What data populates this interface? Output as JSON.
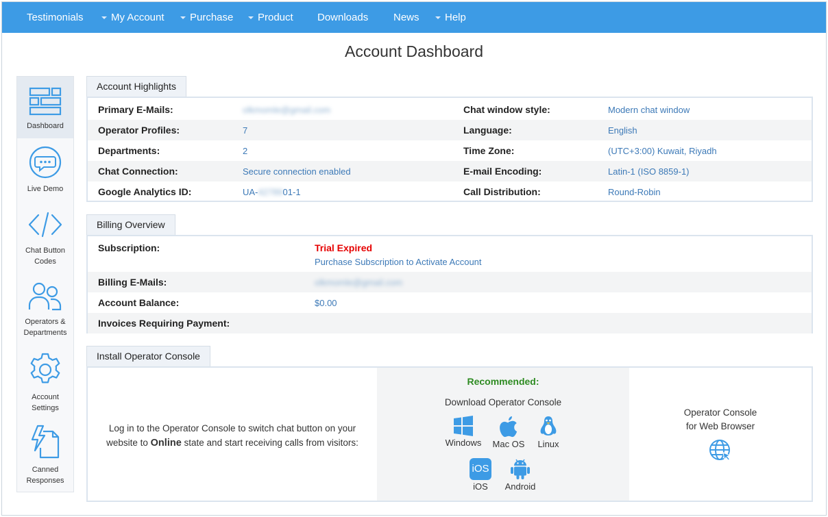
{
  "nav": {
    "items": [
      {
        "label": "Testimonials",
        "has_caret": false
      },
      {
        "label": "My Account",
        "has_caret": true
      },
      {
        "label": "Purchase",
        "has_caret": true
      },
      {
        "label": "Product",
        "has_caret": true
      },
      {
        "label": "Downloads",
        "has_caret": false
      },
      {
        "label": "News",
        "has_caret": false
      },
      {
        "label": "Help",
        "has_caret": true
      }
    ],
    "bg_color": "#3d9be5"
  },
  "page_title": "Account Dashboard",
  "sidebar": {
    "items": [
      {
        "label": "Dashboard",
        "icon": "dashboard-icon",
        "active": true
      },
      {
        "label": "Live Demo",
        "icon": "chat-bubble-icon",
        "active": false
      },
      {
        "label": "Chat Button Codes",
        "icon": "code-icon",
        "active": false
      },
      {
        "label": "Operators & Departments",
        "icon": "users-icon",
        "active": false
      },
      {
        "label": "Account Settings",
        "icon": "gear-icon",
        "active": false
      },
      {
        "label": "Canned Responses",
        "icon": "lightning-doc-icon",
        "active": false
      }
    ]
  },
  "highlights": {
    "tab_label": "Account Highlights",
    "left": [
      {
        "label": "Primary E-Mails:",
        "value": "olkmomle@gmail.com",
        "blurred": true
      },
      {
        "label": "Operator Profiles:",
        "value": "7"
      },
      {
        "label": "Departments:",
        "value": "2"
      },
      {
        "label": "Chat Connection:",
        "value": "Secure connection enabled"
      },
      {
        "label": "Google Analytics ID:",
        "value_prefix": "UA-",
        "value_hidden": "42789",
        "value_suffix": "01-1"
      }
    ],
    "right": [
      {
        "label": "Chat window style:",
        "value": "Modern chat window"
      },
      {
        "label": "Language:",
        "value": "English"
      },
      {
        "label": "Time Zone:",
        "value": "(UTC+3:00) Kuwait, Riyadh"
      },
      {
        "label": "E-mail Encoding:",
        "value": "Latin-1 (ISO 8859-1)"
      },
      {
        "label": "Call Distribution:",
        "value": "Round-Robin"
      }
    ]
  },
  "billing": {
    "tab_label": "Billing Overview",
    "subscription_label": "Subscription:",
    "subscription_status": "Trial Expired",
    "subscription_link": "Purchase Subscription to Activate Account",
    "emails_label": "Billing E-Mails:",
    "emails_value": "olkmomle@gmail.com",
    "balance_label": "Account Balance:",
    "balance_value": "$0.00",
    "invoices_label": "Invoices Requiring Payment:",
    "status_color": "#e60000"
  },
  "install": {
    "tab_label": "Install Operator Console",
    "left_text_1": "Log in to the Operator Console to switch chat button on your",
    "left_text_2a": "website to ",
    "left_text_2b": "Online",
    "left_text_2c": " state and start receiving calls from visitors:",
    "recommended": "Recommended:",
    "download_title": "Download Operator Console",
    "platforms": [
      {
        "label": "Windows",
        "icon": "windows-icon"
      },
      {
        "label": "Mac OS",
        "icon": "apple-icon"
      },
      {
        "label": "Linux",
        "icon": "linux-icon"
      },
      {
        "label": "iOS",
        "icon": "ios-icon",
        "badge": "iOS"
      },
      {
        "label": "Android",
        "icon": "android-icon"
      }
    ],
    "web_line1": "Operator Console",
    "web_line2": "for Web Browser",
    "web_icon": "globe-icon",
    "recommended_color": "#2e8b22"
  }
}
